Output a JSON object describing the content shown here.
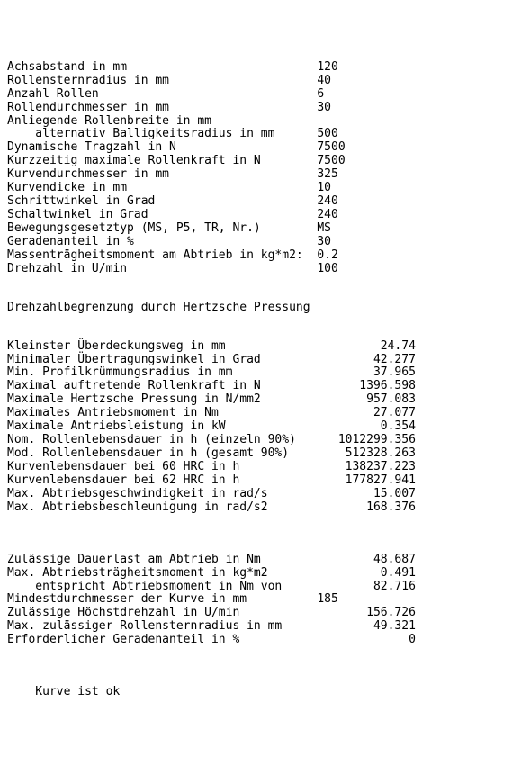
{
  "section1": [
    {
      "label": "Achsabstand in mm",
      "value": "120"
    },
    {
      "label": "Rollensternradius in mm",
      "value": "40"
    },
    {
      "label": "Anzahl Rollen",
      "value": "6"
    },
    {
      "label": "Rollendurchmesser in mm",
      "value": "30"
    },
    {
      "label": "Anliegende Rollenbreite in mm",
      "value": ""
    },
    {
      "label": "    alternativ Balligkeitsradius in mm",
      "value": "500"
    },
    {
      "label": "Dynamische Tragzahl in N",
      "value": "7500"
    },
    {
      "label": "Kurzzeitig maximale Rollenkraft in N",
      "value": "7500"
    },
    {
      "label": "Kurvendurchmesser in mm",
      "value": "325"
    },
    {
      "label": "Kurvendicke in mm",
      "value": "10"
    },
    {
      "label": "Schrittwinkel in Grad",
      "value": "240"
    },
    {
      "label": "Schaltwinkel in Grad",
      "value": "240"
    },
    {
      "label": "Bewegungsgesetztyp (MS, P5, TR, Nr.)",
      "value": "MS"
    },
    {
      "label": "Geradenanteil in %",
      "value": "30"
    },
    {
      "label": "Massenträgheitsmoment am Abtrieb in kg*m2:",
      "value": "0.2"
    },
    {
      "label": "Drehzahl in U/min",
      "value": "100"
    }
  ],
  "heading": "Drehzahlbegrenzung durch Hertzsche Pressung",
  "section2": [
    {
      "label": "Kleinster Überdeckungsweg in mm",
      "value": "24.74"
    },
    {
      "label": "Minimaler Übertragungswinkel in Grad",
      "value": "42.277"
    },
    {
      "label": "Min. Profilkrümmungsradius in mm",
      "value": "37.965"
    },
    {
      "label": "Maximal auftretende Rollenkraft in N",
      "value": "1396.598"
    },
    {
      "label": "Maximale Hertzsche Pressung in N/mm2",
      "value": "957.083"
    },
    {
      "label": "Maximales Antriebsmoment in Nm",
      "value": "27.077"
    },
    {
      "label": "Maximale Antriebsleistung in kW",
      "value": "0.354"
    },
    {
      "label": "Nom. Rollenlebensdauer in h (einzeln 90%)",
      "value": "1012299.356"
    },
    {
      "label": "Mod. Rollenlebensdauer in h (gesamt 90%)",
      "value": "512328.263"
    },
    {
      "label": "Kurvenlebensdauer bei 60 HRC in h",
      "value": "138237.223"
    },
    {
      "label": "Kurvenlebensdauer bei 62 HRC in h",
      "value": "177827.941"
    },
    {
      "label": "Max. Abtriebsgeschwindigkeit in rad/s",
      "value": "15.007"
    },
    {
      "label": "Max. Abtriebsbeschleunigung in rad/s2",
      "value": "168.376"
    }
  ],
  "section3": [
    {
      "label": "Zulässige Dauerlast am Abtrieb in Nm",
      "value": "48.687",
      "align": "right"
    },
    {
      "label": "Max. Abtriebsträgheitsmoment in kg*m2",
      "value": "0.491",
      "align": "right"
    },
    {
      "label": "    entspricht Abtriebsmoment in Nm von",
      "value": "82.716",
      "align": "right"
    },
    {
      "label": "Mindestdurchmesser der Kurve in mm",
      "value": "185",
      "align": "left"
    },
    {
      "label": "Zulässige Höchstdrehzahl in U/min",
      "value": "156.726",
      "align": "right"
    },
    {
      "label": "Max. zulässiger Rollensternradius in mm",
      "value": "49.321",
      "align": "right"
    },
    {
      "label": "Erforderlicher Geradenanteil in %",
      "value": "0",
      "align": "right"
    }
  ],
  "footer": "Kurve ist ok"
}
